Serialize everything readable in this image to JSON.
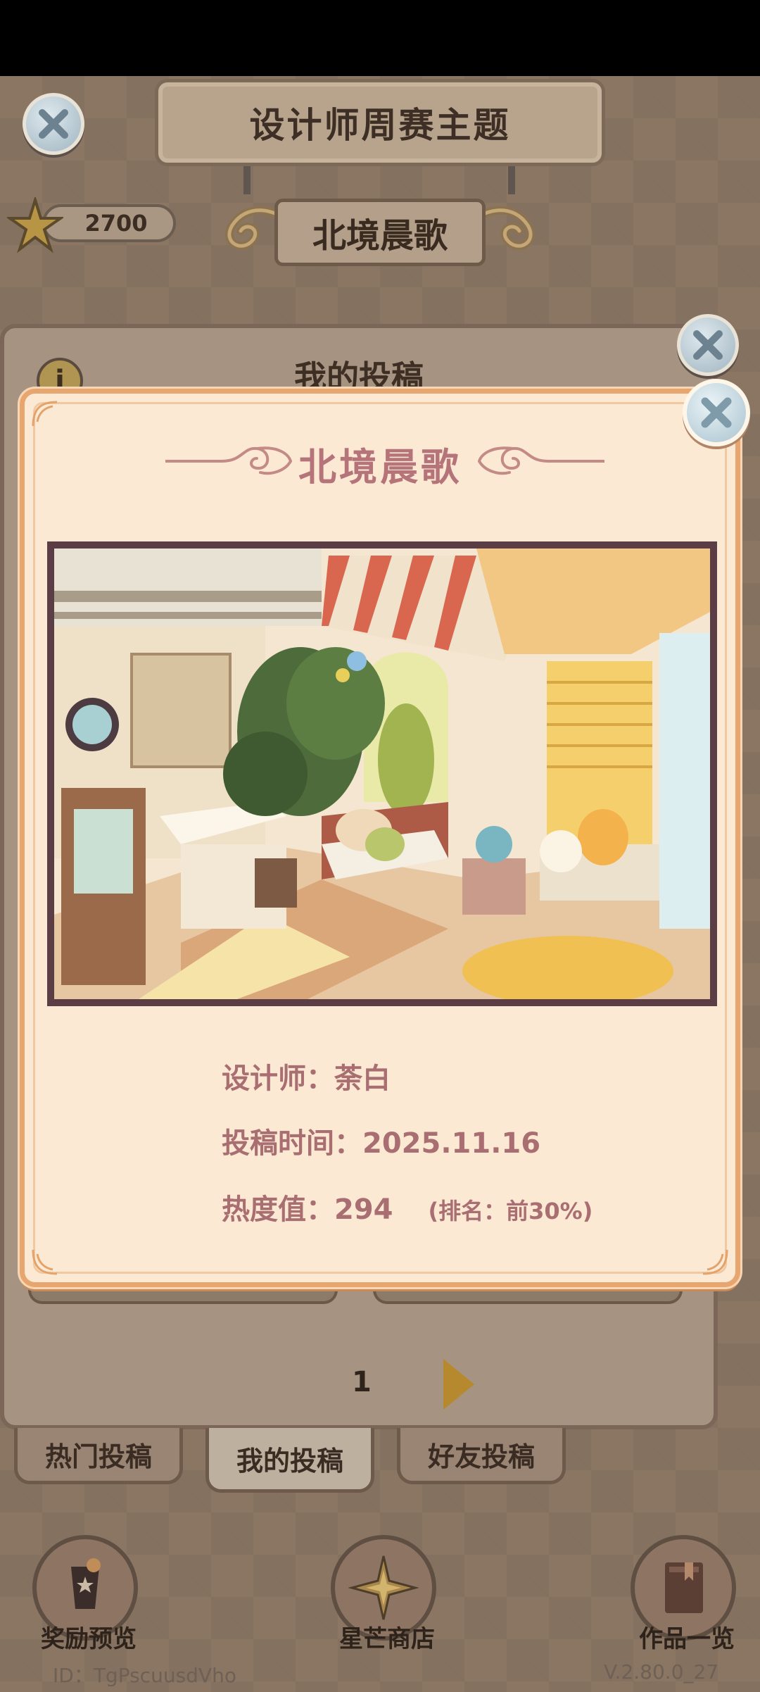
{
  "header": {
    "title": "设计师周赛主题",
    "theme_name": "北境晨歌",
    "stars": "2700"
  },
  "panel": {
    "title": "我的投稿",
    "page": "1"
  },
  "tabs": [
    {
      "label": "热门投稿"
    },
    {
      "label": "我的投稿"
    },
    {
      "label": "好友投稿"
    }
  ],
  "bottom_nav": [
    {
      "label": "奖励预览"
    },
    {
      "label": "星芒商店"
    },
    {
      "label": "作品一览"
    }
  ],
  "footer": {
    "id": "ID：TgPscuusdVho",
    "version": "V.2.80.0_27"
  },
  "modal": {
    "title": "北境晨歌",
    "designer": "设计师：荼白",
    "submit_time_label": "投稿时间：",
    "submit_time": "2025.11.16",
    "heat_label": "热度值：",
    "heat": "294",
    "rank": "(排名：前30%)"
  },
  "colors": {
    "modal_bg": "#fbe9d3",
    "modal_border": "#e7a56f",
    "accent_text": "#b5737a",
    "info_text": "#a96e72"
  }
}
